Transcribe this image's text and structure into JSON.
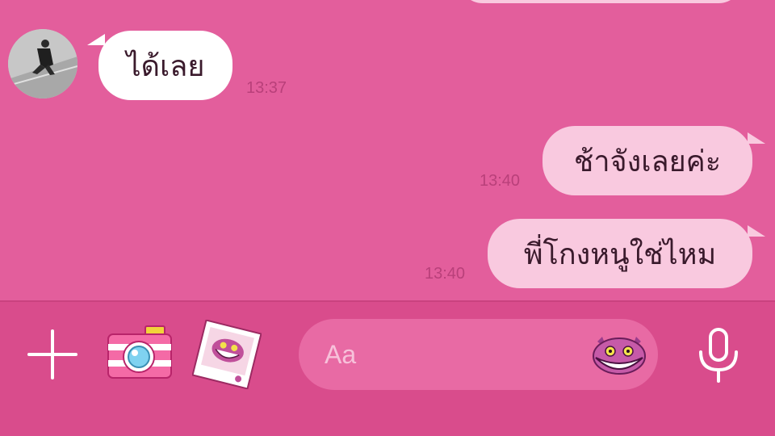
{
  "messages": [
    {
      "id": "m1",
      "side": "in",
      "text": "ได้เลย",
      "time": "13:37"
    },
    {
      "id": "m2",
      "side": "out",
      "text": "ช้าจังเลยค่ะ",
      "time": "13:40"
    },
    {
      "id": "m3",
      "side": "out",
      "text": "พี่โกงหนูใช่ไหม",
      "time": "13:40"
    }
  ],
  "composer": {
    "placeholder": "Aa"
  },
  "icons": {
    "add": "plus-icon",
    "camera": "camera-icon",
    "gallery": "photo-sticker-icon",
    "emoji": "cheshire-cat-emoji-icon",
    "voice": "microphone-icon"
  },
  "colors": {
    "chat_background": "#e35e9c",
    "incoming_bubble": "#ffffff",
    "outgoing_bubble": "#f9c9df",
    "toolbar": "#d94c8c",
    "timestamp": "#b9407a"
  }
}
